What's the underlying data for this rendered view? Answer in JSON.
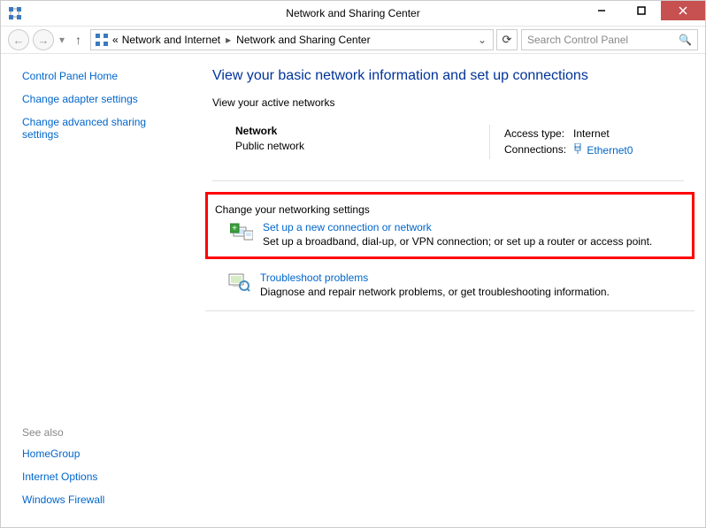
{
  "window": {
    "title": "Network and Sharing Center"
  },
  "breadcrumb": {
    "prefix": "«",
    "item1": "Network and Internet",
    "item2": "Network and Sharing Center"
  },
  "search": {
    "placeholder": "Search Control Panel"
  },
  "sidebar": {
    "home": "Control Panel Home",
    "link1": "Change adapter settings",
    "link2": "Change advanced sharing settings"
  },
  "seealso": {
    "title": "See also",
    "link1": "HomeGroup",
    "link2": "Internet Options",
    "link3": "Windows Firewall"
  },
  "main": {
    "heading": "View your basic network information and set up connections",
    "active_label": "View your active networks",
    "network_name": "Network",
    "network_type": "Public network",
    "access_type_label": "Access type:",
    "access_type_value": "Internet",
    "connections_label": "Connections:",
    "connections_value": "Ethernet0",
    "settings_label": "Change your networking settings",
    "opt1_title": "Set up a new connection or network",
    "opt1_desc": "Set up a broadband, dial-up, or VPN connection; or set up a router or access point.",
    "opt2_title": "Troubleshoot problems",
    "opt2_desc": "Diagnose and repair network problems, or get troubleshooting information."
  }
}
